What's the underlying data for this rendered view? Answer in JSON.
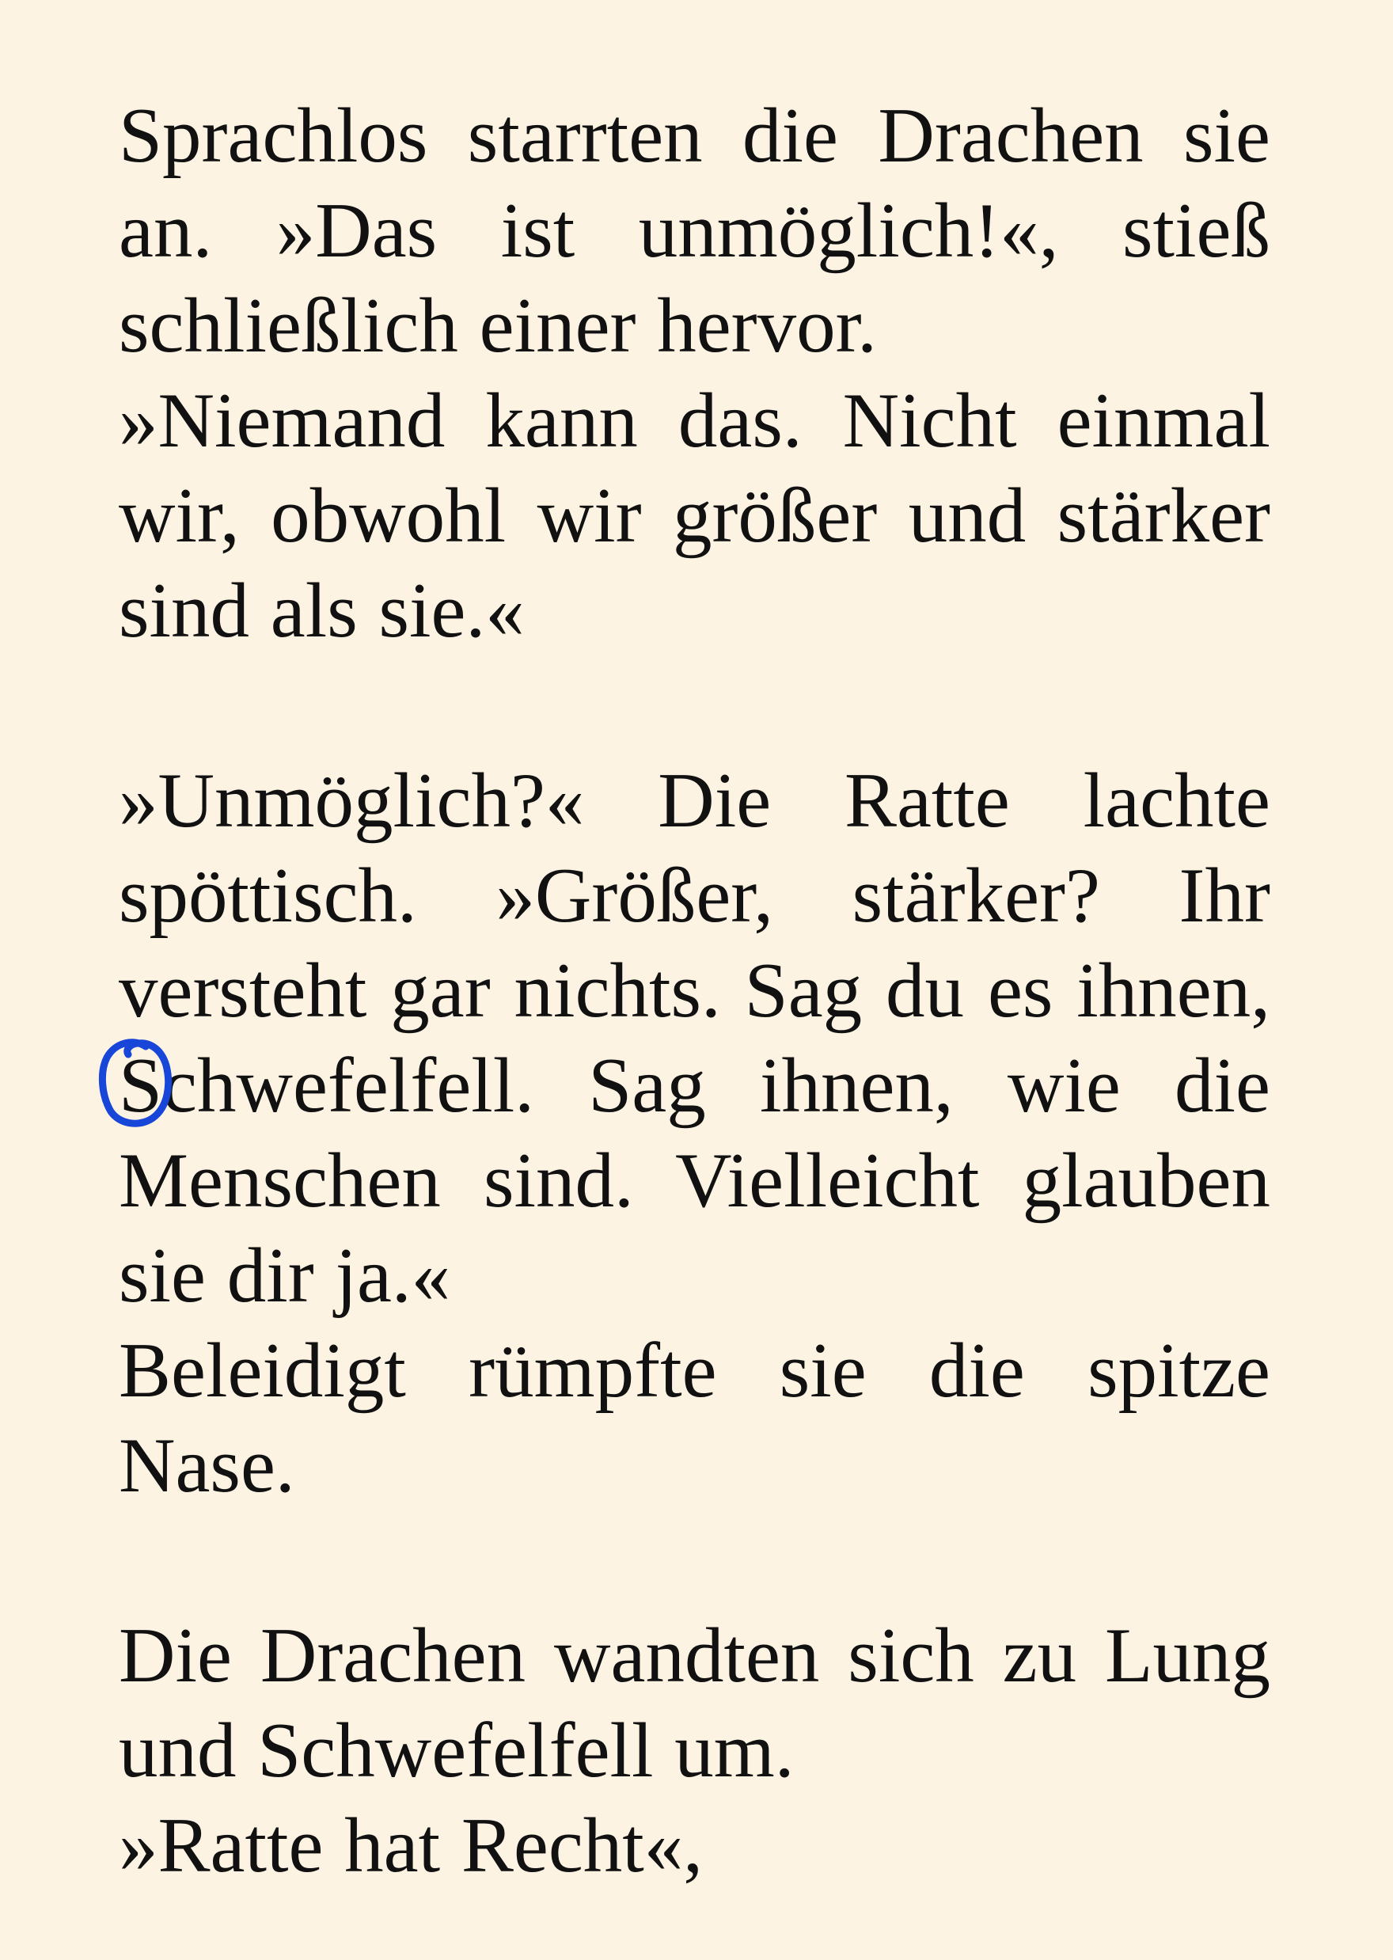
{
  "page": {
    "background": "#fdf3e3",
    "text_color": "#111111",
    "annotation_color": "#1746d8"
  },
  "paragraphs": [
    "Sprachlos starrten die Drachen sie an. »Das ist unmöglich!«, stieß schließlich einer hervor.",
    "»Niemand kann das. Nicht einmal wir, obwohl wir größer und stärker sind als sie.«",
    "»Unmöglich?« Die Ratte lachte spöttisch. »Größer, stärker? Ihr versteht gar nichts. Sag du es ihnen, Schwefelfell. Sag ihnen, wie die Menschen sind. Vielleicht glauben sie dir ja.«",
    "Beleidigt rümpfte sie die spitze Nase.",
    "Die Drachen wandten sich zu Lung und Schwefelfell um.",
    "»Ratte hat Recht«,"
  ],
  "annotation": {
    "type": "hand-drawn circle",
    "target": "S"
  }
}
